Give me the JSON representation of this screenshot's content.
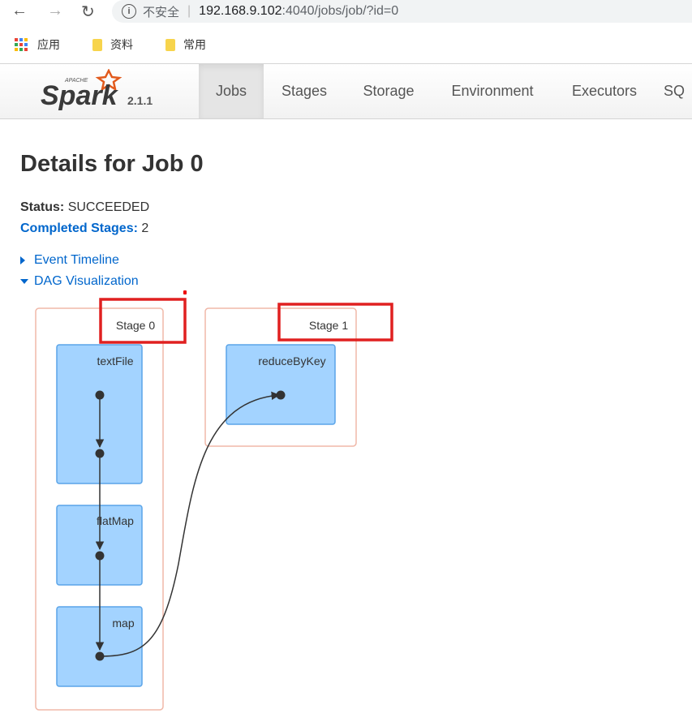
{
  "browser": {
    "address": {
      "insecure_label": "不安全",
      "host": "192.168.9.102",
      "path": ":4040/jobs/job/?id=0"
    },
    "bookmarks": [
      "应用",
      "资料",
      "常用"
    ]
  },
  "navbar": {
    "logo_text": "Spark",
    "logo_apache": "APACHE",
    "version": "2.1.1",
    "tabs": [
      "Jobs",
      "Stages",
      "Storage",
      "Environment",
      "Executors",
      "SQ"
    ],
    "active_tab": "Jobs"
  },
  "page": {
    "title": "Details for Job 0",
    "status_label": "Status:",
    "status_value": "SUCCEEDED",
    "completed_label": "Completed Stages:",
    "completed_value": "2",
    "event_timeline": "Event Timeline",
    "dag_visualization": "DAG Visualization"
  },
  "dag": {
    "stages": [
      {
        "label": "Stage 0",
        "ops": [
          "textFile",
          "flatMap",
          "map"
        ]
      },
      {
        "label": "Stage 1",
        "ops": [
          "reduceByKey"
        ]
      }
    ],
    "colors": {
      "stage_border": "#f0b8a8",
      "op_fill": "#a3d3ff",
      "op_border": "#5aa4e8",
      "highlight": "#e02020",
      "edge": "#333333"
    }
  }
}
